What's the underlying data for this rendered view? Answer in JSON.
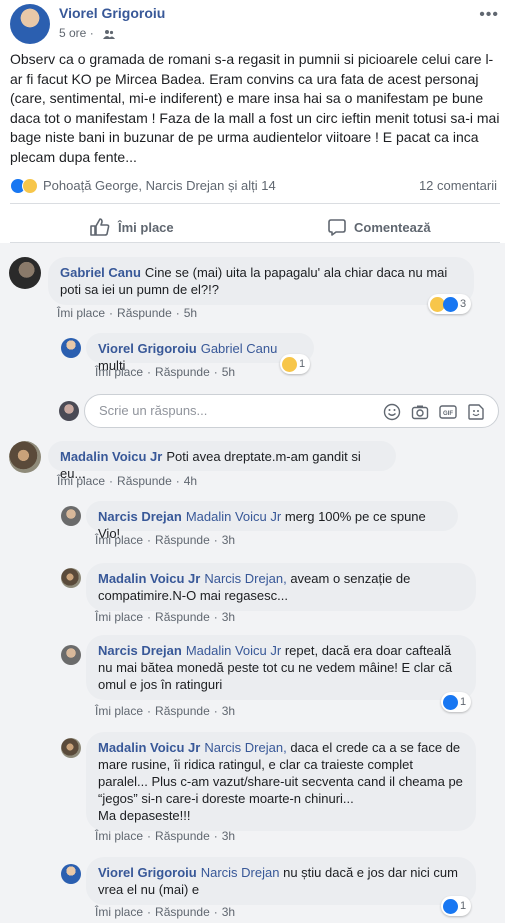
{
  "post": {
    "author": "Viorel Grigoroiu",
    "time": "5 ore",
    "text": "Observ ca o gramada de romani s-a regasit in pumnii si picioarele celui care l-ar fi facut KO pe Mircea Badea. Eram convins ca ura fata de acest personaj (care, sentimental, mi-e indiferent) e mare insa hai sa o manifestam pe bune daca tot o manifestam ! Faza de la mall a fost un circ ieftin menit totusi sa-i mai bage niste bani in buzunar de pe urma audientelor viitoare ! E pacat ca inca plecam dupa fente...",
    "reactions_text": "Pohoață George, Narcis Drejan și alți 14",
    "comments_count": "12 comentarii",
    "like_label": "Îmi place",
    "comment_label": "Comentează"
  },
  "links": {
    "like": "Îmi place",
    "reply": "Răspunde"
  },
  "reply_box": {
    "placeholder": "Scrie un răspuns..."
  },
  "comments": [
    {
      "name": "Gabriel Canu",
      "tag": "",
      "text": "Cine se (mai) uita la papagalu' ala chiar daca nu mai poti sa iei un pumn de el?!?",
      "time": "5h",
      "reaction_count": "3"
    },
    {
      "name": "Viorel Grigoroiu",
      "tag": "Gabriel Canu",
      "text": "multi",
      "time": "5h",
      "reaction_count": "1"
    },
    {
      "name": "Madalin Voicu Jr",
      "tag": "",
      "text": "Poti avea dreptate.m-am gandit si eu...",
      "time": "4h"
    },
    {
      "name": "Narcis Drejan",
      "tag": "Madalin Voicu Jr",
      "text": "merg 100% pe ce spune Vio!",
      "time": "3h"
    },
    {
      "name": "Madalin Voicu Jr",
      "tag": "Narcis Drejan,",
      "text": "aveam o senzație de compatimire.N-O mai regasesc...",
      "time": "3h"
    },
    {
      "name": "Narcis Drejan",
      "tag": "Madalin Voicu Jr",
      "text": "repet, dacă era doar cafteală nu mai bătea monedă peste tot cu ne vedem mâine! E clar că omul e jos în ratinguri",
      "time": "3h",
      "reaction_count": "1"
    },
    {
      "name": "Madalin Voicu Jr",
      "tag": "Narcis Drejan,",
      "text": "daca el crede ca a se face de mare rusine, îi ridica ratingul, e clar ca traieste complet paralel... Plus c-am vazut/share-uit secventa cand il cheama pe “jegos” si-n care-i doreste moarte-n chinuri...",
      "extra": "Ma depaseste!!!",
      "time": "3h"
    },
    {
      "name": "Viorel Grigoroiu",
      "tag": "Narcis Drejan",
      "text": "nu știu dacă e jos dar nici cum vrea el nu (mai) e",
      "time": "3h",
      "reaction_count": "1"
    }
  ]
}
